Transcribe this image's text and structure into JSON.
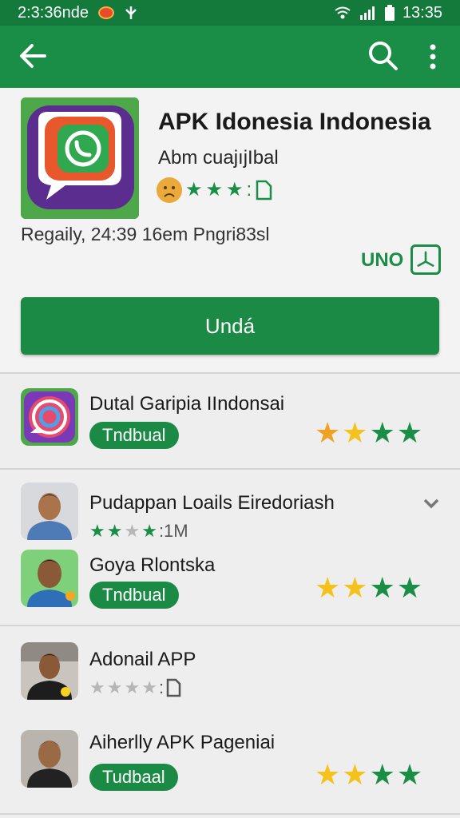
{
  "status_bar": {
    "time_left": "2:3:36nde",
    "time_right": "13:35"
  },
  "app_header": {
    "title": "APK Idonesia Indonesia",
    "subtitle": "Abm cuajıjIbal",
    "rating_suffix": ":",
    "meta_line": "Regaily, 24:39 16em Pngri83sl",
    "uno_label": "UNO",
    "install_button": "Undá"
  },
  "items": [
    {
      "title": "Dutal Garipia IIndonsai",
      "pill": "Tndbual"
    },
    {
      "title": "Pudappan Loails Eiredoriash",
      "count": ":1M"
    },
    {
      "title": "Goya Rlontska",
      "pill": "Tndbual"
    },
    {
      "title": "Adonail APP",
      "suffix": ":"
    },
    {
      "title": "Aiherlly APK Pageniai",
      "pill": "Tudbaal"
    }
  ],
  "colors": {
    "primary": "#1a8e47",
    "statusbar": "#137a3c",
    "star_gold": "#f5c21b"
  }
}
